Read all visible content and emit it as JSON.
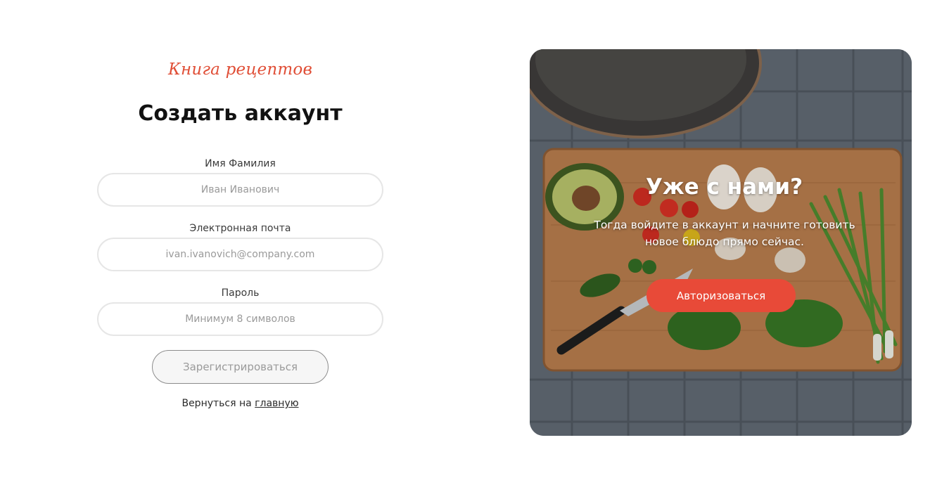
{
  "brand": "Книга рецептов",
  "title": "Создать аккаунт",
  "form": {
    "name": {
      "label": "Имя Фамилия",
      "placeholder": "Иван Иванович"
    },
    "email": {
      "label": "Электронная почта",
      "placeholder": "ivan.ivanovich@company.com"
    },
    "password": {
      "label": "Пароль",
      "placeholder": "Минимум 8 символов"
    },
    "submit_label": "Зарегистрироваться"
  },
  "back": {
    "prefix": "Вернуться на ",
    "link": "главную"
  },
  "promo": {
    "title": "Уже с нами?",
    "text": "Тогда войдите в аккаунт и начните готовить новое блюдо прямо сейчас.",
    "button_label": "Авторизоваться"
  },
  "colors": {
    "accent": "#e84a38",
    "brand": "#e04e36"
  }
}
